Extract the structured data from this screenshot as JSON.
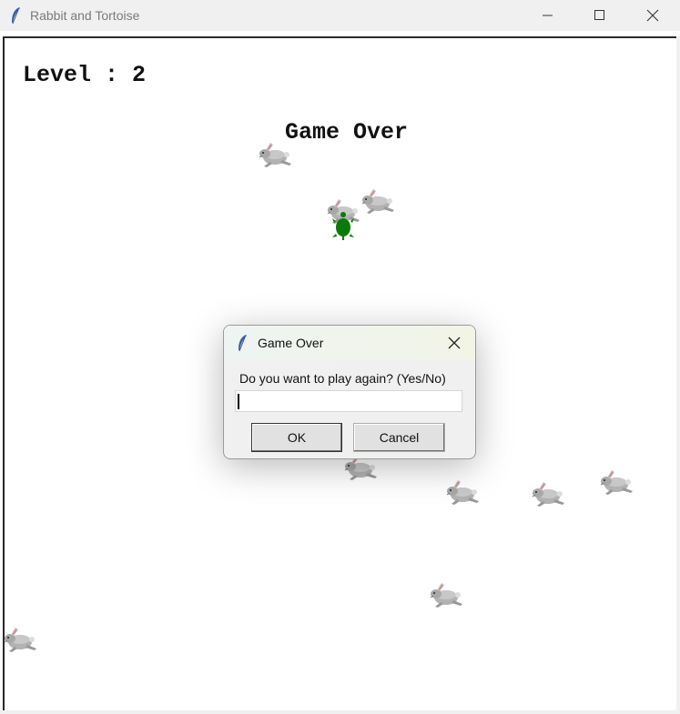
{
  "window": {
    "title": "Rabbit and Tortoise",
    "icon": "feather-icon",
    "controls": [
      "minimize-icon",
      "maximize-icon",
      "close-icon"
    ]
  },
  "game": {
    "level_text": "Level : 2",
    "status_text": "Game Over",
    "sprites": {
      "rabbit": "rabbit-icon",
      "tortoise": "tortoise-icon"
    }
  },
  "dialog": {
    "title": "Game Over",
    "prompt": "Do you want to play again? (Yes/No)",
    "input_value": "",
    "ok_label": "OK",
    "cancel_label": "Cancel"
  },
  "colors": {
    "tortoise": "#0a7a0a",
    "rabbit_body": "#a9a9a9",
    "rabbit_ear": "#d98c8c"
  }
}
